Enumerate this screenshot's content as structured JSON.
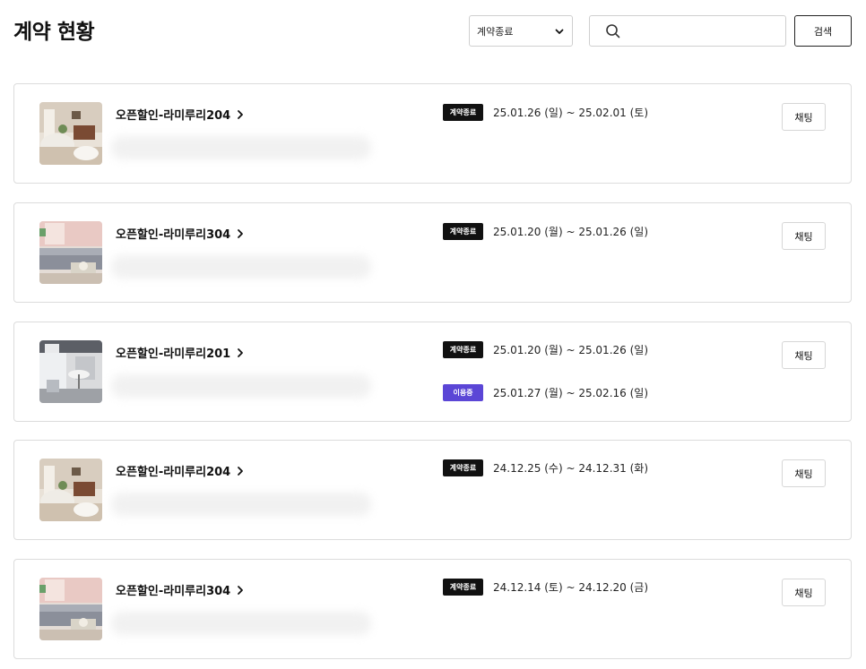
{
  "header": {
    "title": "계약 현황",
    "filter_selected": "계약종료",
    "search_placeholder": "",
    "search_label": "검색"
  },
  "status_colors": {
    "ended": "#111111",
    "active": "#5b46d6"
  },
  "icons": {
    "search": "search-icon",
    "filter": "chevron-down-icon",
    "room_link": "chevron-right-icon"
  },
  "contracts": [
    {
      "room": "오픈할인-라미루리204",
      "chat_label": "채팅",
      "periods": [
        {
          "status": "계약종료",
          "dates": "25.01.26 (일) ~ 25.02.01 (토)"
        }
      ]
    },
    {
      "room": "오픈할인-라미루리304",
      "chat_label": "채팅",
      "periods": [
        {
          "status": "계약종료",
          "dates": "25.01.20 (월) ~ 25.01.26 (일)"
        }
      ]
    },
    {
      "room": "오픈할인-라미루리201",
      "chat_label": "채팅",
      "periods": [
        {
          "status": "계약종료",
          "dates": "25.01.20 (월) ~ 25.01.26 (일)"
        },
        {
          "status": "이용중",
          "dates": "25.01.27 (월) ~ 25.02.16 (일)"
        }
      ]
    },
    {
      "room": "오픈할인-라미루리204",
      "chat_label": "채팅",
      "periods": [
        {
          "status": "계약종료",
          "dates": "24.12.25 (수) ~ 24.12.31 (화)"
        }
      ]
    },
    {
      "room": "오픈할인-라미루리304",
      "chat_label": "채팅",
      "periods": [
        {
          "status": "계약종료",
          "dates": "24.12.14 (토) ~ 24.12.20 (금)"
        }
      ]
    }
  ]
}
